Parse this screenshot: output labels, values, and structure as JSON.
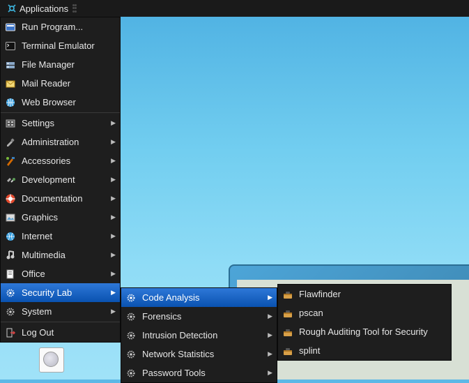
{
  "panel": {
    "app_menu_label": "Applications"
  },
  "menu": {
    "run_program": "Run Program...",
    "terminal": "Terminal Emulator",
    "file_manager": "File Manager",
    "mail_reader": "Mail Reader",
    "web_browser": "Web Browser",
    "settings": "Settings",
    "administration": "Administration",
    "accessories": "Accessories",
    "development": "Development",
    "documentation": "Documentation",
    "graphics": "Graphics",
    "internet": "Internet",
    "multimedia": "Multimedia",
    "office": "Office",
    "security_lab": "Security Lab",
    "system": "System",
    "log_out": "Log Out"
  },
  "security_submenu": {
    "code_analysis": "Code Analysis",
    "forensics": "Forensics",
    "intrusion_detection": "Intrusion Detection",
    "network_statistics": "Network Statistics",
    "password_tools": "Password Tools"
  },
  "code_analysis_submenu": {
    "flawfinder": "Flawfinder",
    "pscan": "pscan",
    "rats": "Rough Auditing Tool for Security",
    "splint": "splint"
  }
}
